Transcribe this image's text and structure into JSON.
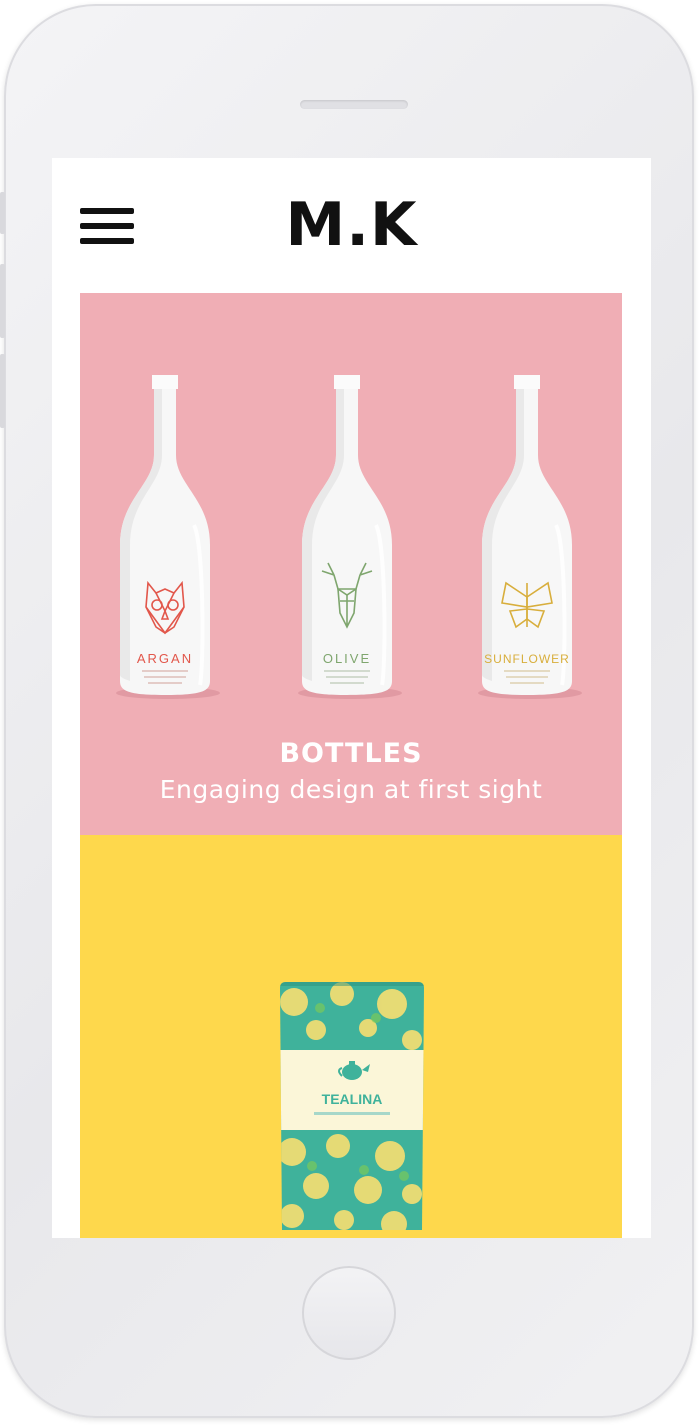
{
  "app": {
    "logo": "M.K",
    "menu_icon": "hamburger-menu-icon"
  },
  "colors": {
    "card_bottles_bg": "#f0aeb5",
    "card_tea_bg": "#fed84c",
    "caption_text": "#ffffff",
    "logo": "#111111"
  },
  "portfolio": {
    "items": [
      {
        "title": "BOTTLES",
        "subtitle": "Engaging design at first sight",
        "bottles": [
          {
            "label": "ARGAN",
            "icon": "owl-icon",
            "color": "#e2574b"
          },
          {
            "label": "OLIVE",
            "icon": "deer-icon",
            "color": "#7fa66e"
          },
          {
            "label": "SUNFLOWER",
            "icon": "butterfly-icon",
            "color": "#d8ae3c"
          }
        ]
      },
      {
        "product_label": "TEALINA",
        "icon": "teapot-icon"
      }
    ]
  }
}
